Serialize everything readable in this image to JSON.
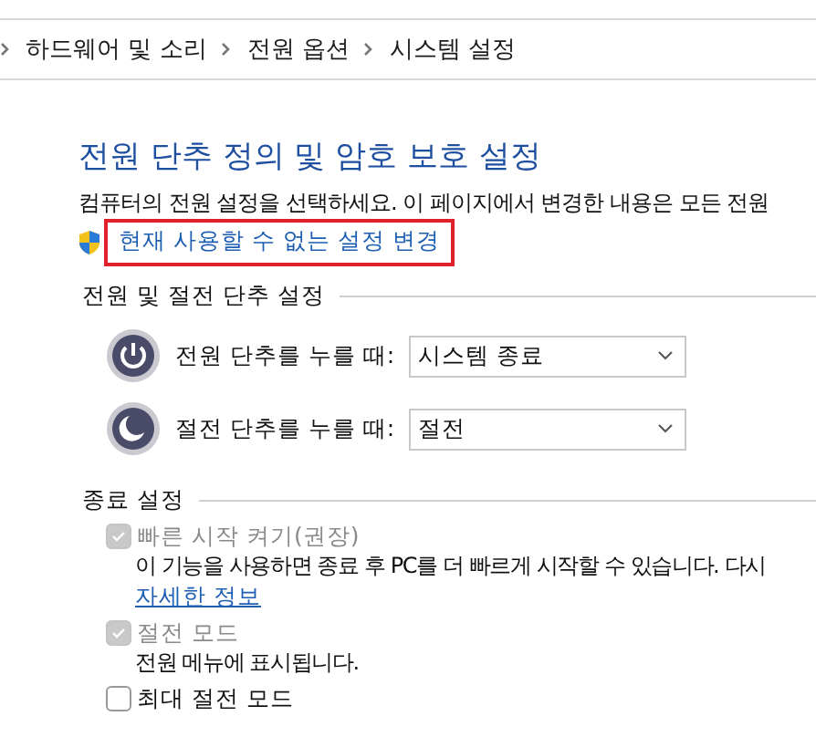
{
  "breadcrumb": {
    "items": [
      "하드웨어 및 소리",
      "전원 옵션",
      "시스템 설정"
    ]
  },
  "title": "전원 단추 정의 및 암호 보호 설정",
  "description": "컴퓨터의 전원 설정을 선택하세요. 이 페이지에서 변경한 내용은 모든 전원",
  "admin_link": {
    "label": "현재 사용할 수 없는 설정 변경",
    "highlighted": true
  },
  "button_settings": {
    "heading": "전원 및 절전 단추 설정",
    "rows": [
      {
        "kind": "power",
        "label": "전원 단추를 누를 때:",
        "value": "시스템 종료"
      },
      {
        "kind": "sleep",
        "label": "절전 단추를 누를 때:",
        "value": "절전"
      }
    ]
  },
  "shutdown_settings": {
    "heading": "종료 설정",
    "options": [
      {
        "label": "빠른 시작 켜기(권장)",
        "checked": true,
        "disabled": true,
        "description": "이 기능을 사용하면 종료 후 PC를 더 빠르게 시작할 수 있습니다. 다시",
        "link": "자세한 정보"
      },
      {
        "label": "절전 모드",
        "checked": true,
        "disabled": true,
        "description": "전원 메뉴에 표시됩니다."
      },
      {
        "label": "최대 절전 모드",
        "checked": false,
        "disabled": false
      }
    ]
  }
}
